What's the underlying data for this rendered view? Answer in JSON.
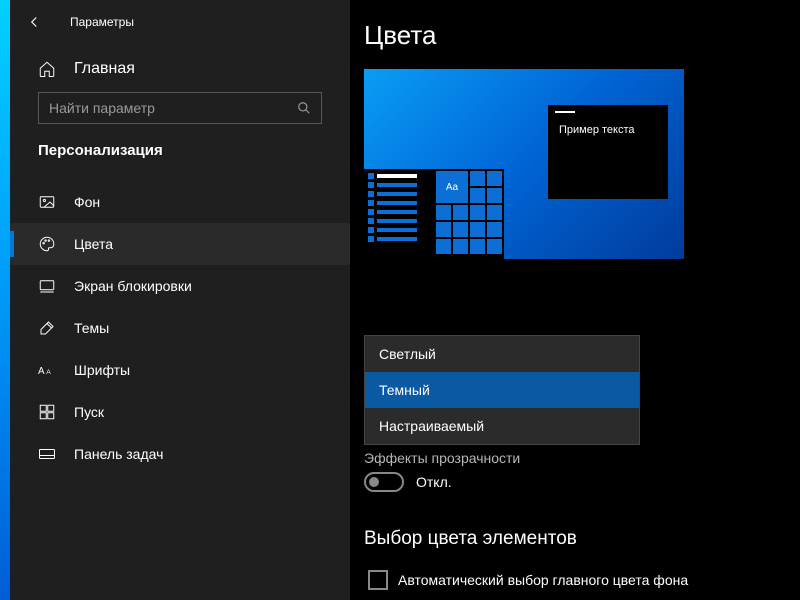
{
  "app_title": "Параметры",
  "home_label": "Главная",
  "search": {
    "placeholder": "Найти параметр"
  },
  "section": "Персонализация",
  "nav": [
    {
      "id": "background",
      "label": "Фон",
      "icon": "picture-icon"
    },
    {
      "id": "colors",
      "label": "Цвета",
      "icon": "palette-icon",
      "selected": true
    },
    {
      "id": "lockscreen",
      "label": "Экран блокировки",
      "icon": "lockscreen-icon"
    },
    {
      "id": "themes",
      "label": "Темы",
      "icon": "themes-icon"
    },
    {
      "id": "fonts",
      "label": "Шрифты",
      "icon": "fonts-icon"
    },
    {
      "id": "start",
      "label": "Пуск",
      "icon": "start-icon"
    },
    {
      "id": "taskbar",
      "label": "Панель задач",
      "icon": "taskbar-icon"
    }
  ],
  "page_title": "Цвета",
  "preview": {
    "sample_text": "Пример текста",
    "tile_label": "Aa"
  },
  "color_mode_dropdown": {
    "options": [
      {
        "id": "light",
        "label": "Светлый"
      },
      {
        "id": "dark",
        "label": "Темный",
        "selected": true
      },
      {
        "id": "custom",
        "label": "Настраиваемый"
      }
    ]
  },
  "transparency": {
    "heading_partial": "Эффекты прозрачности",
    "state_label": "Откл.",
    "enabled": false
  },
  "accent_section": {
    "heading": "Выбор цвета элементов",
    "auto_checkbox_label": "Автоматический выбор главного цвета фона",
    "auto_checked": false
  },
  "colors": {
    "accent": "#0078d4",
    "dropdown_selected": "#0a5aa3"
  }
}
